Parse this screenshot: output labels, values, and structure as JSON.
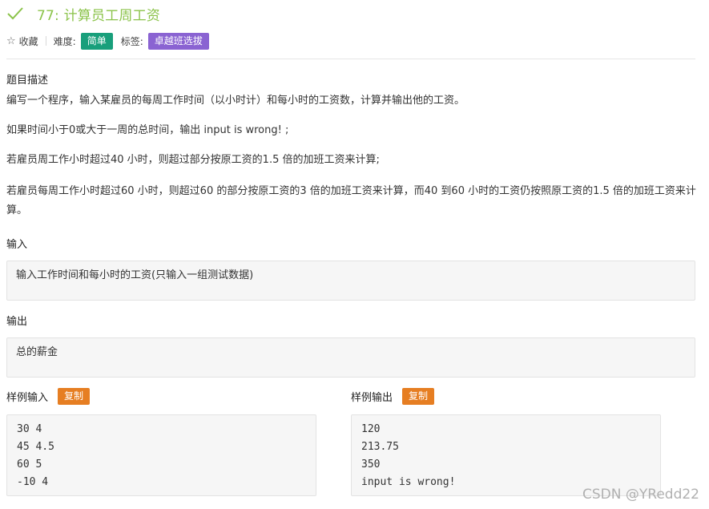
{
  "problem": {
    "title": "77: 计算员工周工资",
    "favorite_label": "收藏",
    "difficulty_label": "难度:",
    "difficulty_value": "简单",
    "tags_label": "标签:",
    "tag_value": "卓越班选拔"
  },
  "description": {
    "heading": "题目描述",
    "paragraphs": [
      "编写一个程序，输入某雇员的每周工作时间（以小时计）和每小时的工资数，计算并输出他的工资。",
      "如果时间小于0或大于一周的总时间，输出 input is wrong! ;",
      "若雇员周工作小时超过40 小时，则超过部分按原工资的1.5 倍的加班工资来计算;",
      "若雇员每周工作小时超过60 小时，则超过60 的部分按原工资的3 倍的加班工资来计算，而40 到60 小时的工资仍按照原工资的1.5 倍的加班工资来计算。"
    ]
  },
  "input": {
    "heading": "输入",
    "content": "输入工作时间和每小时的工资(只输入一组测试数据)"
  },
  "output": {
    "heading": "输出",
    "content": "总的薪金"
  },
  "sample_input": {
    "label": "样例输入",
    "copy_label": "复制",
    "lines": [
      "30 4",
      "45 4.5",
      "60 5",
      "-10 4"
    ]
  },
  "sample_output": {
    "label": "样例输出",
    "copy_label": "复制",
    "lines": [
      "120",
      "213.75",
      "350",
      "input is wrong!"
    ]
  },
  "watermark": "CSDN @YRedd22",
  "colors": {
    "title_green": "#8bc34a",
    "difficulty_badge": "#189f7b",
    "tag_badge": "#8a63d2",
    "copy_button": "#e67e22"
  }
}
